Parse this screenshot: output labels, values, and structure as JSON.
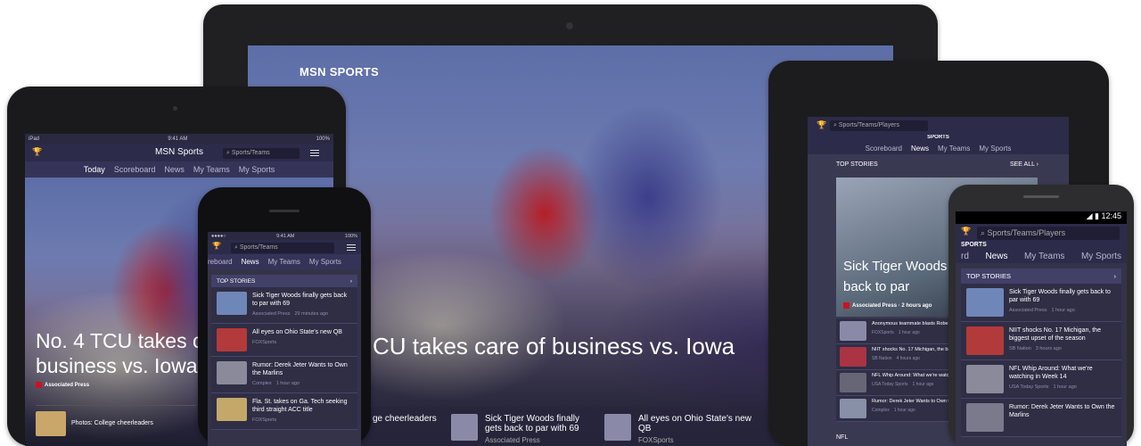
{
  "tablet_large": {
    "brand": "MSN SPORTS",
    "headline": "CU takes care of business vs. Iowa",
    "strip": [
      {
        "title": "ge cheerleaders",
        "source": ""
      },
      {
        "title": "Sick Tiger Woods finally gets back to par with 69",
        "source": "Associated Press"
      },
      {
        "title": "All eyes on Ohio State's new QB",
        "source": "FOXSports"
      }
    ]
  },
  "ipad": {
    "status_left": "iPad",
    "status_time": "9:41 AM",
    "status_right": "100%",
    "app_title": "MSN Sports",
    "search_placeholder": "Sports/Teams",
    "nav": [
      "Today",
      "Scoreboard",
      "News",
      "My Teams",
      "My Sports"
    ],
    "headline": "No. 4 TCU takes care of business vs. Iowa",
    "headline_source": "Associated Press",
    "bottom_item": "Photos: College cheerleaders"
  },
  "iphone": {
    "status_time": "9:41 AM",
    "status_right": "100%",
    "search_placeholder": "Sports/Teams",
    "nav": [
      "reboard",
      "News",
      "My Teams",
      "My Sports"
    ],
    "section": "TOP STORIES",
    "stories": [
      {
        "title": "Sick Tiger Woods finally gets back to par with 69",
        "source": "Associated Press",
        "time": "29 minutes ago"
      },
      {
        "title": "All eyes on Ohio State's new QB",
        "source": "FOXSports",
        "time": ""
      },
      {
        "title": "Rumor: Derek Jeter Wants to Own the Marlins",
        "source": "Complex",
        "time": "1 hour ago"
      },
      {
        "title": "Fla. St. takes on Ga. Tech seeking third straight ACC title",
        "source": "FOXSports",
        "time": ""
      }
    ]
  },
  "tablet_right": {
    "search_placeholder": "Sports/Teams/Players",
    "section_label": "SPORTS",
    "nav": [
      "Scoreboard",
      "News",
      "My Teams",
      "My Sports"
    ],
    "top_stories": "TOP STORIES",
    "see_all": "SEE ALL",
    "hero_headline": "Sick Tiger Woods finally gets back to par",
    "hero_source": "Associated Press · 2 hours ago",
    "stories": [
      {
        "title": "Anonymous teammate blasts Robert Griffin III",
        "source": "FOXSports",
        "time": "1 hour ago"
      },
      {
        "title": "NIIT shocks No. 17 Michigan, the biggest upset of the season",
        "source": "SB Nation",
        "time": "4 hours ago"
      },
      {
        "title": "NFL Whip Around: What we're watching in Week 14",
        "source": "USA Today Sports",
        "time": "1 hour ago"
      },
      {
        "title": "Rumor: Derek Jeter Wants to Own the Marlins",
        "source": "Complex",
        "time": "1 hour ago"
      }
    ],
    "footer_label": "NFL"
  },
  "android": {
    "status_time": "12:45",
    "search_placeholder": "Sports/Teams/Players",
    "section_label": "SPORTS",
    "nav": [
      "rd",
      "News",
      "My Teams",
      "My Sports"
    ],
    "top_stories": "TOP STORIES",
    "stories": [
      {
        "title": "Sick Tiger Woods finally gets back to par with 69",
        "source": "Associated Press",
        "time": "1 hour ago"
      },
      {
        "title": "NIIT shocks No. 17 Michigan, the biggest upset of the season",
        "source": "SB Nation",
        "time": "3 hours ago"
      },
      {
        "title": "NFL Whip Around: What we're watching in Week 14",
        "source": "USA Today Sports",
        "time": "1 hour ago"
      },
      {
        "title": "Rumor: Derek Jeter Wants to Own the Marlins",
        "source": "",
        "time": ""
      }
    ]
  },
  "colors": {
    "app_bar": "#2c2b49",
    "nav_bar": "#353458",
    "panel": "#2f2e45",
    "accent_red": "#cc1122"
  }
}
